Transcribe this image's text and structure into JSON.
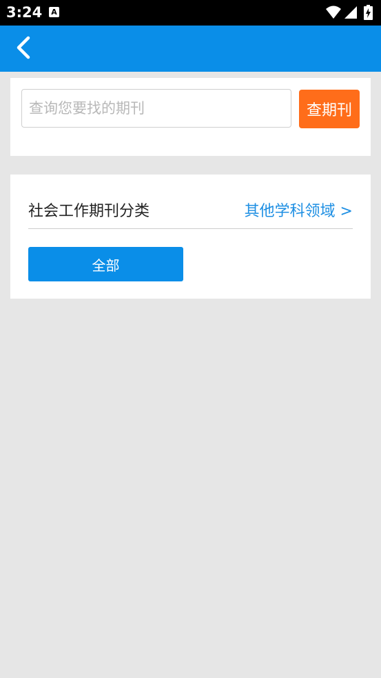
{
  "status_bar": {
    "time": "3:24",
    "notification_icon_letter": "A",
    "icons": [
      "a-notification-icon",
      "wifi-icon",
      "cellular-signal-icon",
      "battery-charging-icon"
    ]
  },
  "app_bar": {
    "back_icon": "chevron-left-icon",
    "color": "#0a8ee8"
  },
  "search": {
    "value": "",
    "placeholder": "查询您要找的期刊",
    "button_label": "查期刊",
    "button_color": "#ff6d1a"
  },
  "category": {
    "title": "社会工作期刊分类",
    "other_fields_link": "其他学科领域 >",
    "link_color": "#1e8fe3",
    "buttons": [
      {
        "label": "全部"
      }
    ]
  }
}
